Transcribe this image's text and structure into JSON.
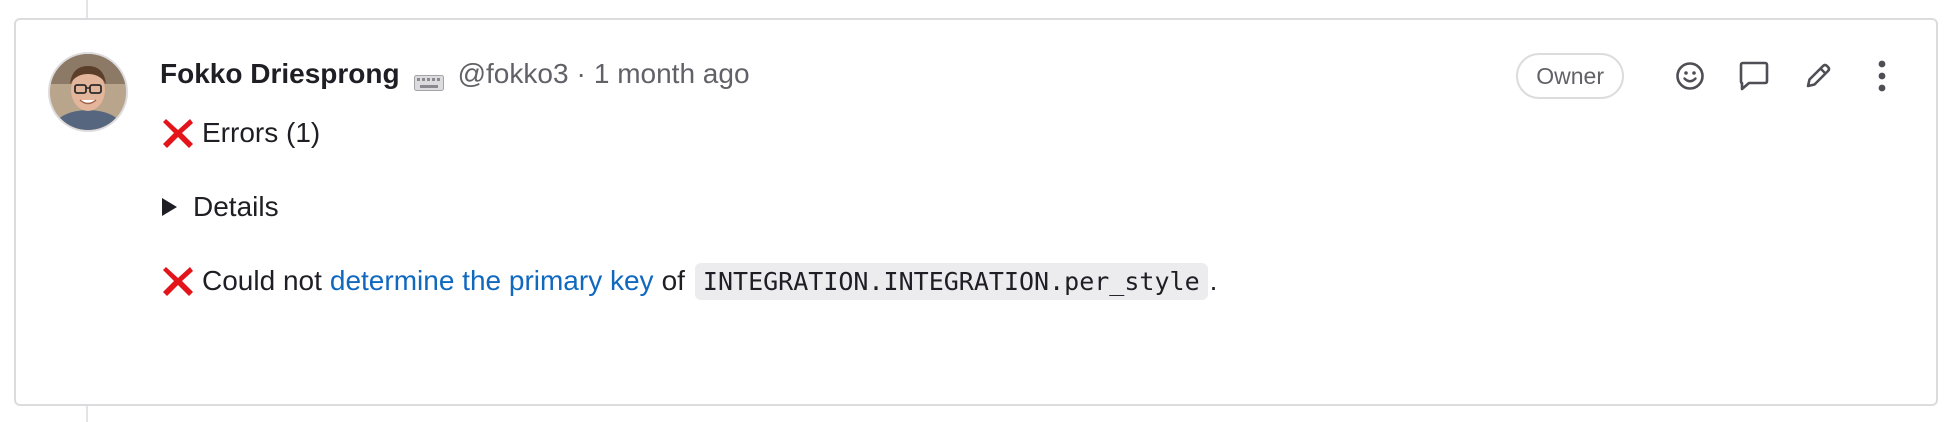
{
  "note": {
    "author": {
      "name": "Fokko Driesprong",
      "handle": "@fokko3",
      "separator": "·",
      "timestamp": "1 month ago",
      "status_icon": "keyboard-icon"
    },
    "badge": "Owner",
    "actions": [
      {
        "name": "add-reaction",
        "icon": "smiley-icon"
      },
      {
        "name": "reply",
        "icon": "comment-icon"
      },
      {
        "name": "edit",
        "icon": "pencil-icon"
      },
      {
        "name": "more-actions",
        "icon": "kebab-icon"
      }
    ],
    "body": {
      "errors_heading": "Errors (1)",
      "details_label": "Details",
      "error_prefix": "Could not",
      "error_link": "determine the primary key",
      "error_middle": "of",
      "error_code": "INTEGRATION.INTEGRATION.per_style",
      "error_suffix": "."
    }
  },
  "colors": {
    "error_red": "#e4141b",
    "link_blue": "#1068bf",
    "border": "#dcdcde",
    "muted_text": "#626168"
  }
}
